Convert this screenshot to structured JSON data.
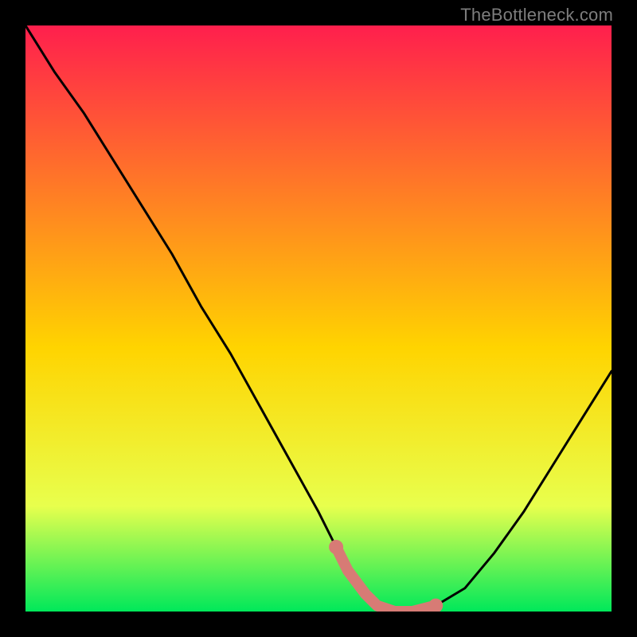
{
  "watermark": "TheBottleneck.com",
  "colors": {
    "frame": "#000000",
    "gradient_top": "#ff1f4d",
    "gradient_mid": "#ffd400",
    "gradient_low": "#e8ff4d",
    "gradient_bottom": "#00e85a",
    "curve": "#000000",
    "highlight": "#d77b75"
  },
  "chart_data": {
    "type": "line",
    "title": "",
    "xlabel": "",
    "ylabel": "",
    "xlim": [
      0,
      100
    ],
    "ylim": [
      0,
      100
    ],
    "series": [
      {
        "name": "bottleneck-curve",
        "x": [
          0,
          5,
          10,
          15,
          20,
          25,
          30,
          35,
          40,
          45,
          50,
          53,
          55,
          58,
          60,
          63,
          66,
          70,
          75,
          80,
          85,
          90,
          95,
          100
        ],
        "values": [
          100,
          92,
          85,
          77,
          69,
          61,
          52,
          44,
          35,
          26,
          17,
          11,
          7,
          3,
          1,
          0,
          0,
          1,
          4,
          10,
          17,
          25,
          33,
          41
        ]
      },
      {
        "name": "highlight-segment",
        "x": [
          53,
          55,
          58,
          60,
          63,
          66,
          70
        ],
        "values": [
          11,
          7,
          3,
          1,
          0,
          0,
          1
        ]
      }
    ],
    "highlight_markers": [
      {
        "x": 53,
        "y": 11
      },
      {
        "x": 70,
        "y": 1
      }
    ]
  }
}
